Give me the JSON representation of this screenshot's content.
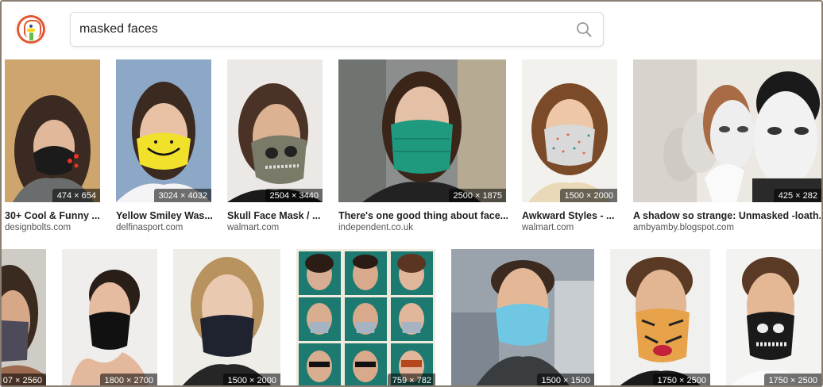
{
  "search": {
    "query": "masked faces"
  },
  "row1": [
    {
      "dims": "474 × 654",
      "title": "30+ Cool & Funny ...",
      "source": "designbolts.com"
    },
    {
      "dims": "3024 × 4032",
      "title": "Yellow Smiley Was...",
      "source": "delfinasport.com"
    },
    {
      "dims": "2504 × 3440",
      "title": "Skull Face Mask / ...",
      "source": "walmart.com"
    },
    {
      "dims": "2500 × 1875",
      "title": "There's one good thing about face...",
      "source": "independent.co.uk"
    },
    {
      "dims": "1500 × 2000",
      "title": "Awkward Styles - ...",
      "source": "walmart.com"
    },
    {
      "dims": "425 × 282",
      "title": "A shadow so strange: Unmasked -loath...",
      "source": "ambyamby.blogspot.com"
    }
  ],
  "row2": [
    {
      "dims": "07 × 2560"
    },
    {
      "dims": "1800 × 2700"
    },
    {
      "dims": "1500 × 2000"
    },
    {
      "dims": "759 × 782"
    },
    {
      "dims": "1500 × 1500"
    },
    {
      "dims": "1750 × 2500"
    },
    {
      "dims": "1750 × 2500"
    }
  ],
  "colors": {
    "brand": "#de5833",
    "border": "#8a7f73"
  }
}
